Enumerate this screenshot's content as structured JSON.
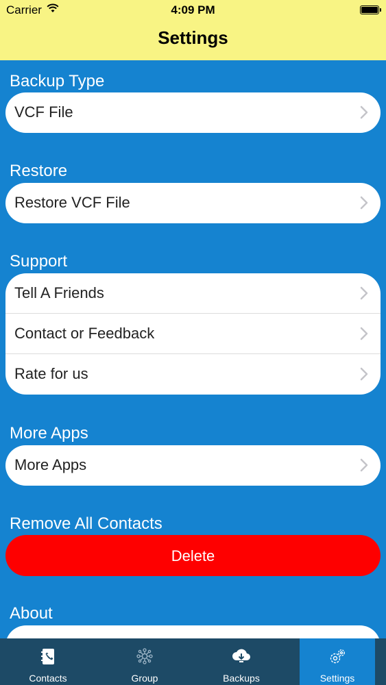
{
  "status_bar": {
    "carrier": "Carrier",
    "time": "4:09 PM"
  },
  "nav": {
    "title": "Settings"
  },
  "sections": {
    "backup_type": {
      "label": "Backup Type",
      "items": [
        "VCF File"
      ]
    },
    "restore": {
      "label": "Restore",
      "items": [
        "Restore VCF File"
      ]
    },
    "support": {
      "label": "Support",
      "items": [
        "Tell A Friends",
        "Contact or Feedback",
        "Rate for us"
      ]
    },
    "more_apps": {
      "label": "More Apps",
      "items": [
        "More Apps"
      ]
    },
    "remove_all": {
      "label": "Remove All Contacts",
      "button": "Delete"
    },
    "about": {
      "label": "About"
    }
  },
  "tabs": [
    {
      "label": "Contacts",
      "icon": "contacts-book-icon"
    },
    {
      "label": "Group",
      "icon": "group-network-icon"
    },
    {
      "label": "Backups",
      "icon": "cloud-download-icon"
    },
    {
      "label": "Settings",
      "icon": "gear-icon"
    }
  ],
  "colors": {
    "nav_background": "#f8f484",
    "page_background": "#1583d0",
    "delete_button": "#fe0000",
    "tab_bar": "#1d4a66",
    "tab_active": "#1583d0"
  }
}
